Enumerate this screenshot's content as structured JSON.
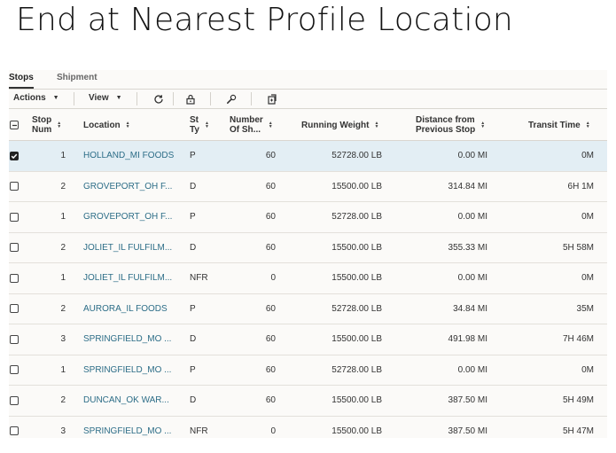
{
  "slide_title": "End at Nearest Profile Location",
  "tabs": [
    {
      "label": "Stops",
      "active": true
    },
    {
      "label": "Shipment",
      "active": false
    }
  ],
  "toolbar": {
    "actions_label": "Actions",
    "view_label": "View",
    "icons": [
      "refresh-icon",
      "lock-icon",
      "wrench-icon",
      "export-icon"
    ]
  },
  "columns": {
    "select": "",
    "stop_num": "Stop\nNum",
    "location": "Location",
    "stop_type": "St\nTy",
    "num_shipments": "Number\nOf Sh...",
    "running_weight": "Running Weight",
    "distance": "Distance from\nPrevious Stop",
    "transit_time": "Transit Time"
  },
  "colors": {
    "link": "#2c6d87",
    "selected_row": "#e3eef4",
    "panel_bg": "#fbfaf8"
  },
  "rows": [
    {
      "checked": true,
      "stop_num": "1",
      "location": "HOLLAND_MI FOODS",
      "stop_type": "P",
      "num_shipments": "60",
      "running_weight": "52728.00 LB",
      "distance": "0.00 MI",
      "transit_time": "0M"
    },
    {
      "checked": false,
      "stop_num": "2",
      "location": "GROVEPORT_OH F...",
      "stop_type": "D",
      "num_shipments": "60",
      "running_weight": "15500.00 LB",
      "distance": "314.84 MI",
      "transit_time": "6H 1M"
    },
    {
      "checked": false,
      "stop_num": "1",
      "location": "GROVEPORT_OH F...",
      "stop_type": "P",
      "num_shipments": "60",
      "running_weight": "52728.00 LB",
      "distance": "0.00 MI",
      "transit_time": "0M"
    },
    {
      "checked": false,
      "stop_num": "2",
      "location": "JOLIET_IL FULFILM...",
      "stop_type": "D",
      "num_shipments": "60",
      "running_weight": "15500.00 LB",
      "distance": "355.33 MI",
      "transit_time": "5H 58M"
    },
    {
      "checked": false,
      "stop_num": "1",
      "location": "JOLIET_IL FULFILM...",
      "stop_type": "NFR",
      "num_shipments": "0",
      "running_weight": "15500.00 LB",
      "distance": "0.00 MI",
      "transit_time": "0M"
    },
    {
      "checked": false,
      "stop_num": "2",
      "location": "AURORA_IL FOODS",
      "stop_type": "P",
      "num_shipments": "60",
      "running_weight": "52728.00 LB",
      "distance": "34.84 MI",
      "transit_time": "35M"
    },
    {
      "checked": false,
      "stop_num": "3",
      "location": "SPRINGFIELD_MO ...",
      "stop_type": "D",
      "num_shipments": "60",
      "running_weight": "15500.00 LB",
      "distance": "491.98 MI",
      "transit_time": "7H 46M"
    },
    {
      "checked": false,
      "stop_num": "1",
      "location": "SPRINGFIELD_MO ...",
      "stop_type": "P",
      "num_shipments": "60",
      "running_weight": "52728.00 LB",
      "distance": "0.00 MI",
      "transit_time": "0M"
    },
    {
      "checked": false,
      "stop_num": "2",
      "location": "DUNCAN_OK WAR...",
      "stop_type": "D",
      "num_shipments": "60",
      "running_weight": "15500.00 LB",
      "distance": "387.50 MI",
      "transit_time": "5H 49M"
    },
    {
      "checked": false,
      "stop_num": "3",
      "location": "SPRINGFIELD_MO ...",
      "stop_type": "NFR",
      "num_shipments": "0",
      "running_weight": "15500.00 LB",
      "distance": "387.50 MI",
      "transit_time": "5H 47M"
    }
  ]
}
